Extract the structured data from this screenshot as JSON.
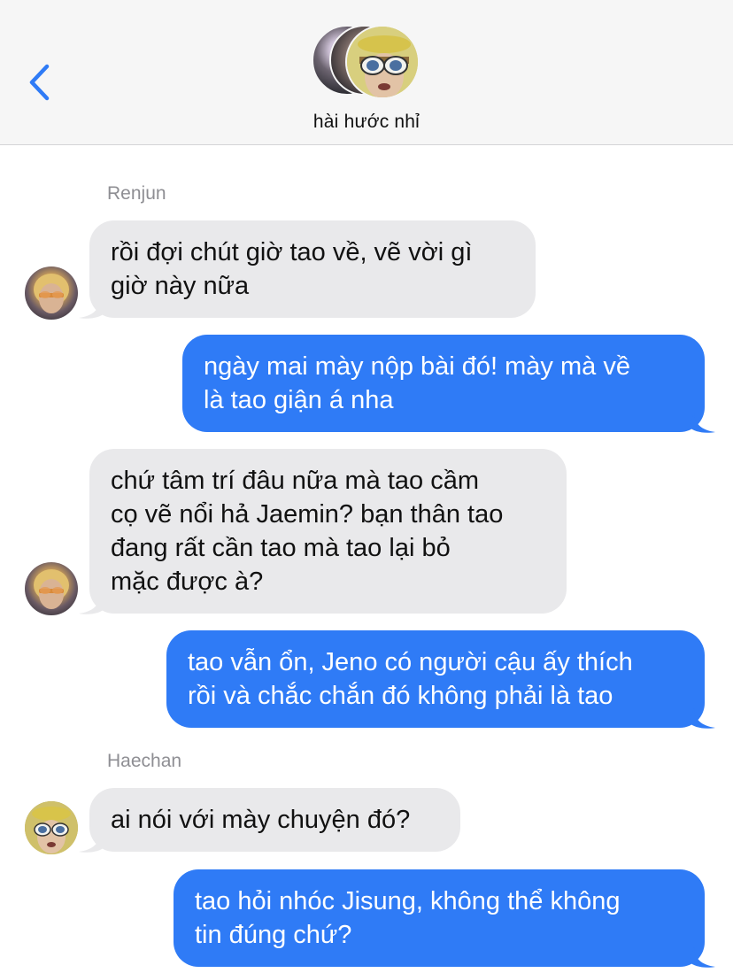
{
  "header": {
    "group_name": "hài hước nhỉ"
  },
  "icons": {
    "back": "chevron-left-icon",
    "accent": "#2f7bf6"
  },
  "colors": {
    "outgoing_bubble": "#2f7bf6",
    "incoming_bubble": "#e9e9eb",
    "sender_label": "#8e8e93"
  },
  "messages": [
    {
      "sender": "Renjun",
      "direction": "in",
      "text": "rồi đợi chút giờ tao về, vẽ vời gì\ngiờ này nữa"
    },
    {
      "direction": "out",
      "text": "ngày mai mày nộp bài đó! mày mà về\nlà tao giận á nha"
    },
    {
      "direction": "in",
      "text": "chứ tâm trí đâu nữa mà tao cầm\ncọ vẽ nổi hả Jaemin? bạn thân tao\nđang rất cần tao mà tao lại bỏ\nmặc được à?"
    },
    {
      "direction": "out",
      "text": "tao vẫn ổn, Jeno có người cậu ấy thích\nrồi và chắc chắn đó không phải là tao"
    },
    {
      "sender": "Haechan",
      "direction": "in",
      "text": "ai nói với mày chuyện đó?"
    },
    {
      "direction": "out",
      "text": "tao hỏi nhóc Jisung, không thể không\ntin đúng chứ?"
    }
  ]
}
